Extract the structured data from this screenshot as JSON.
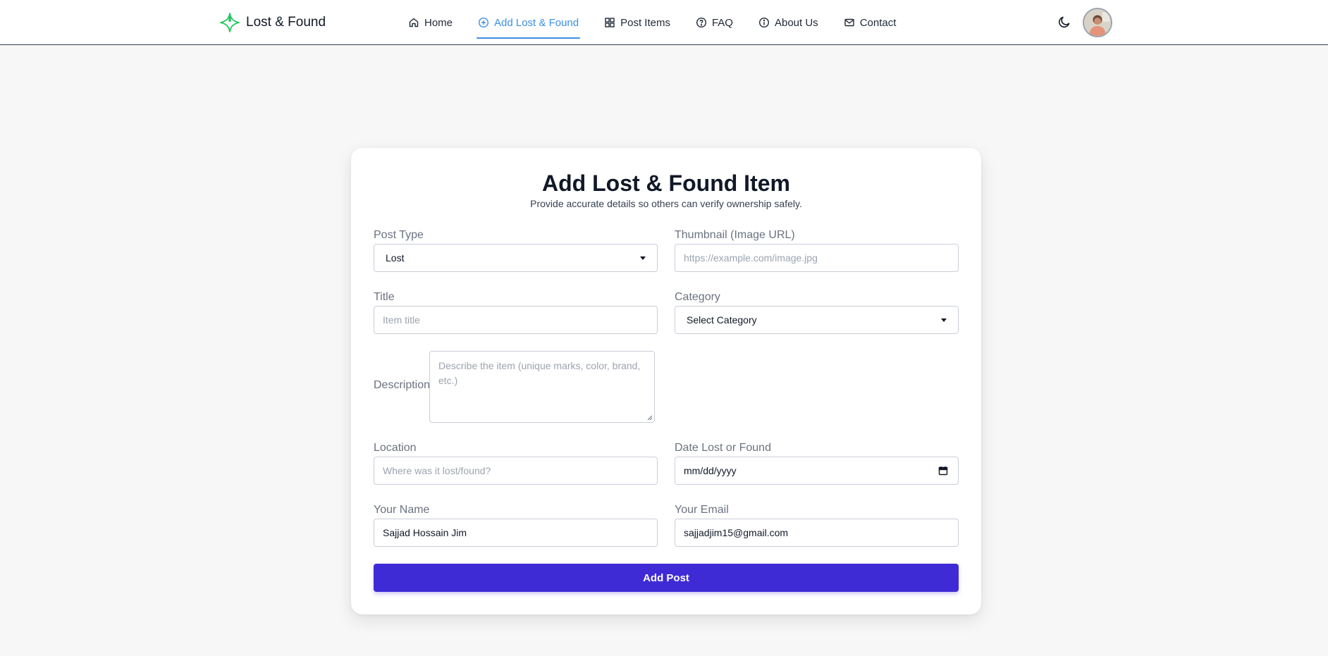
{
  "brand": {
    "name": "Lost & Found",
    "logo_icon": "sparkle-cross-icon",
    "accent": "#22c55e"
  },
  "nav": {
    "items": [
      {
        "label": "Home",
        "icon": "home-icon"
      },
      {
        "label": "Add Lost & Found",
        "icon": "plus-circle-icon",
        "active": true
      },
      {
        "label": "Post Items",
        "icon": "grid-icon"
      },
      {
        "label": "FAQ",
        "icon": "question-circle-icon"
      },
      {
        "label": "About Us",
        "icon": "info-circle-icon"
      },
      {
        "label": "Contact",
        "icon": "mail-icon"
      }
    ],
    "active_color": "#3b8fe8",
    "theme_icon": "moon-icon",
    "avatar_icon": "user-avatar"
  },
  "form": {
    "title": "Add Lost & Found Item",
    "subtitle": "Provide accurate details so others can verify ownership safely.",
    "post_type": {
      "label": "Post Type",
      "value": "Lost"
    },
    "thumbnail": {
      "label": "Thumbnail (Image URL)",
      "placeholder": "https://example.com/image.jpg"
    },
    "title_field": {
      "label": "Title",
      "placeholder": "Item title"
    },
    "category": {
      "label": "Category",
      "value": "Select Category"
    },
    "description": {
      "label": "Description",
      "placeholder": "Describe the item (unique marks, color, brand, etc.)"
    },
    "location": {
      "label": "Location",
      "placeholder": "Where was it lost/found?"
    },
    "date": {
      "label": "Date Lost or Found",
      "value": "mm/dd/yyyy"
    },
    "name": {
      "label": "Your Name",
      "value": "Sajjad Hossain Jim"
    },
    "email": {
      "label": "Your Email",
      "value": "sajjadjim15@gmail.com"
    },
    "submit_label": "Add Post",
    "submit_color": "#3f2bd6"
  }
}
